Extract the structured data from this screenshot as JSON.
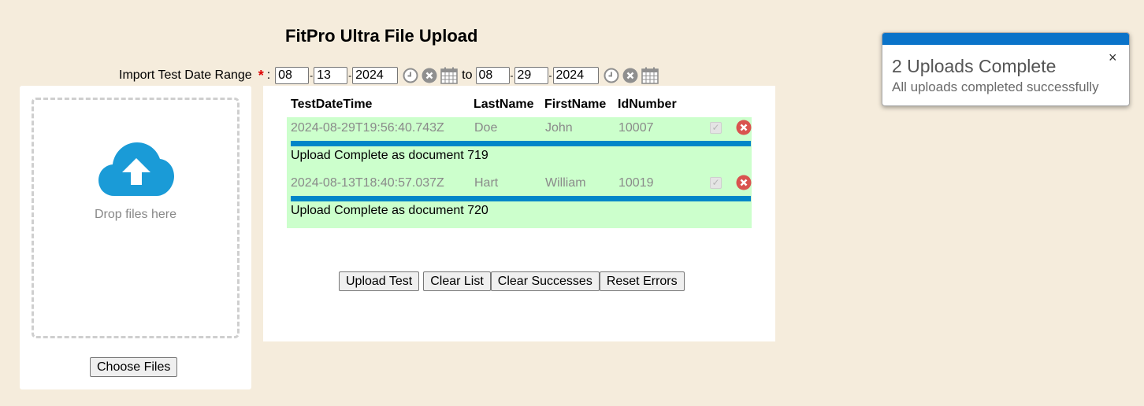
{
  "page": {
    "title": "FitPro Ultra File Upload"
  },
  "date_range": {
    "label": "Import Test Date Range",
    "required_marker": "*",
    "colon": ":",
    "separator": "-",
    "to_label": "to",
    "from": {
      "month": "08",
      "day": "13",
      "year": "2024"
    },
    "to": {
      "month": "08",
      "day": "29",
      "year": "2024"
    }
  },
  "dropzone": {
    "text": "Drop files here",
    "choose_files_label": "Choose Files",
    "icon": "cloud-upload-icon"
  },
  "table": {
    "headers": [
      "TestDateTime",
      "LastName",
      "FirstName",
      "IdNumber"
    ],
    "rows": [
      {
        "test_date_time": "2024-08-29T19:56:40.743Z",
        "last_name": "Doe",
        "first_name": "John",
        "id_number": "10007",
        "progress_percent": 100,
        "status": "Upload Complete as document 719",
        "checked": true
      },
      {
        "test_date_time": "2024-08-13T18:40:57.037Z",
        "last_name": "Hart",
        "first_name": "William",
        "id_number": "10019",
        "progress_percent": 100,
        "status": "Upload Complete as document 720",
        "checked": true
      }
    ]
  },
  "actions": {
    "upload_test": "Upload Test",
    "clear_list": "Clear List",
    "clear_successes": "Clear Successes",
    "reset_errors": "Reset Errors"
  },
  "toast": {
    "title": "2 Uploads Complete",
    "message": "All uploads completed successfully",
    "close": "×"
  },
  "colors": {
    "background": "#f5ecdc",
    "row_success": "#ccffcc",
    "progress": "#0086c8",
    "remove": "#d9534f",
    "toast_accent": "#0a73c9",
    "upload_icon": "#1a9bd7"
  }
}
